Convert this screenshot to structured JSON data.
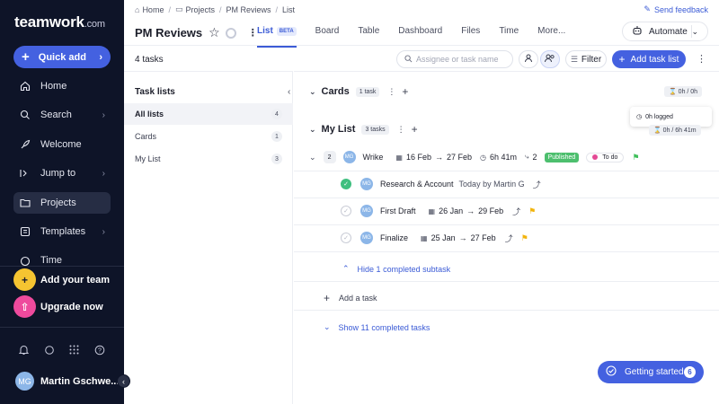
{
  "sidebar": {
    "logo": "teamwork",
    "logo_suffix": ".com",
    "quick_add": "Quick add",
    "items": [
      {
        "label": "Home"
      },
      {
        "label": "Search"
      },
      {
        "label": "Welcome"
      },
      {
        "label": "Jump to"
      },
      {
        "label": "Projects"
      },
      {
        "label": "Templates"
      },
      {
        "label": "Time"
      }
    ],
    "add_team": "Add your team",
    "upgrade": "Upgrade now",
    "user_initials": "MG",
    "user_name": "Martin Gschwe..."
  },
  "breadcrumb": {
    "home": "Home",
    "projects": "Projects",
    "project": "PM Reviews",
    "current": "List"
  },
  "feedback": "Send feedback",
  "project": {
    "title": "PM Reviews"
  },
  "tabs": [
    {
      "label": "List",
      "badge": "BETA"
    },
    {
      "label": "Board"
    },
    {
      "label": "Table"
    },
    {
      "label": "Dashboard"
    },
    {
      "label": "Files"
    },
    {
      "label": "Time"
    },
    {
      "label": "More..."
    }
  ],
  "automate": "Automate",
  "toolbar": {
    "task_count": "4 tasks",
    "search_placeholder": "Assignee or task name",
    "filter": "Filter",
    "add_task_list": "Add task list"
  },
  "panel": {
    "title": "Task lists",
    "items": [
      {
        "label": "All lists",
        "count": "4"
      },
      {
        "label": "Cards",
        "count": "1"
      },
      {
        "label": "My List",
        "count": "3"
      }
    ]
  },
  "lists": {
    "cards": {
      "name": "Cards",
      "count": "1 task",
      "time": "0h / 0h",
      "tooltip": "0h logged"
    },
    "mylist": {
      "name": "My List",
      "count": "3 tasks",
      "time": "0h / 6h 41m"
    }
  },
  "tasks": {
    "parent": {
      "subtask_count": "2",
      "initials": "MG",
      "name": "Wrike",
      "start": "16 Feb",
      "end": "27 Feb",
      "estimate": "6h 41m",
      "dependencies": "2",
      "tag": "Published",
      "status": "To do",
      "flag_color": "#3fbf5a"
    },
    "subtasks": [
      {
        "initials": "MG",
        "name": "Research & Account",
        "meta": "Today by Martin G",
        "done": true
      },
      {
        "initials": "MG",
        "name": "First Draft",
        "start": "26 Jan",
        "end": "29 Feb",
        "flag_color": "#f2b40c"
      },
      {
        "initials": "MG",
        "name": "Finalize",
        "start": "25 Jan",
        "end": "27 Feb",
        "flag_color": "#f2b40c"
      }
    ]
  },
  "hide_completed": "Hide 1 completed subtask",
  "add_task": "Add a task",
  "show_completed": "Show 11 completed tasks",
  "getting_started": {
    "label": "Getting started",
    "count": "6"
  }
}
